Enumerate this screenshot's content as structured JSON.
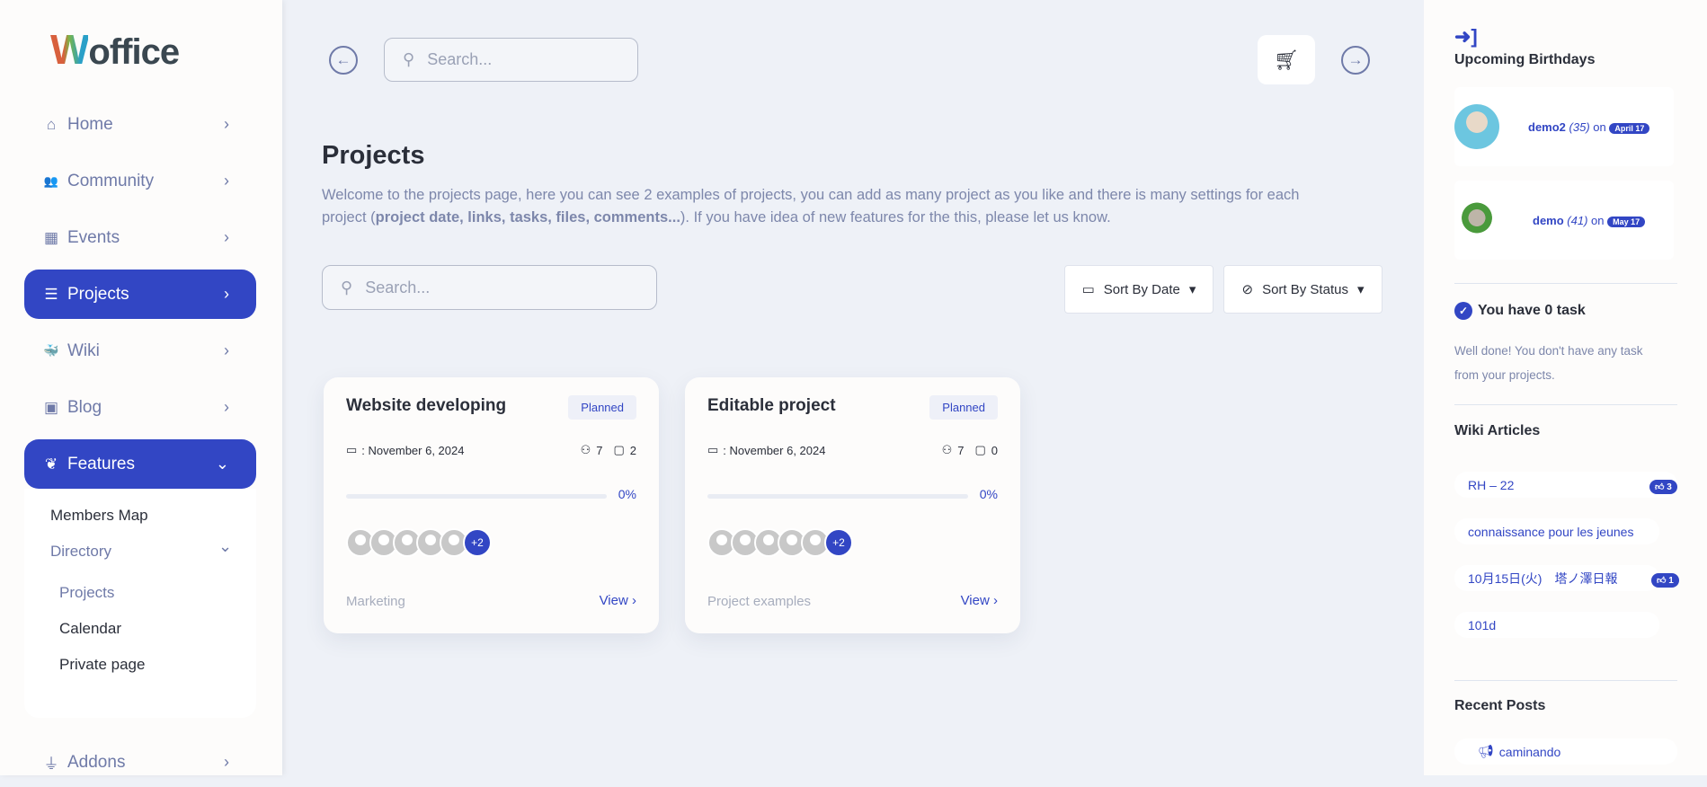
{
  "logo": {
    "text": "Woffice",
    "first": "W",
    "rest": "office"
  },
  "sidebar": {
    "items": [
      {
        "label": "Home",
        "icon": "home-icon",
        "glyph": "⌂"
      },
      {
        "label": "Community",
        "icon": "users-icon",
        "glyph": "👥"
      },
      {
        "label": "Events",
        "icon": "calendar-icon",
        "glyph": "▦"
      },
      {
        "label": "Projects",
        "icon": "tasks-icon",
        "glyph": "☰",
        "active": true
      },
      {
        "label": "Wiki",
        "icon": "docker-icon",
        "glyph": "🐳"
      },
      {
        "label": "Blog",
        "icon": "blogger-icon",
        "glyph": "▣"
      },
      {
        "label": "Features",
        "icon": "feather-icon",
        "glyph": "❦",
        "active": true,
        "expanded": true
      },
      {
        "label": "Addons",
        "icon": "plug-icon",
        "glyph": "⏚"
      }
    ],
    "features_sub": {
      "members_map": "Members Map",
      "directory": "Directory",
      "directory_items": [
        "Projects",
        "Calendar",
        "Private page"
      ]
    }
  },
  "topbar": {
    "search_placeholder": "Search..."
  },
  "page": {
    "title": "Projects",
    "desc_1": "Welcome to the projects page, here you can see 2 examples of projects, you can add as many project as you like and there is many settings for each",
    "desc_2a": "project (",
    "desc_bold": "project date, links, tasks, files, comments...",
    "desc_2b": "). If you have idea of new features for the this, please let us know."
  },
  "filters": {
    "search_placeholder": "Search...",
    "sort_date": "Sort By Date",
    "sort_status": "Sort By Status"
  },
  "projects": [
    {
      "title": "Website developing",
      "status": "Planned",
      "date": ": November 6, 2024",
      "members": "7",
      "comments": "2",
      "progress": "0%",
      "extra": "+2",
      "category": "Marketing",
      "view": "View"
    },
    {
      "title": "Editable project",
      "status": "Planned",
      "date": ": November 6, 2024",
      "members": "7",
      "comments": "0",
      "progress": "0%",
      "extra": "+2",
      "category": "Project examples",
      "view": "View"
    }
  ],
  "right": {
    "birthdays_title": "Upcoming Birthdays",
    "birthdays": [
      {
        "name": "demo2",
        "age": "(35)",
        "on": "on",
        "date": "April 17"
      },
      {
        "name": "demo",
        "age": "(41)",
        "on": "on",
        "date": "May 17"
      }
    ],
    "task_title": "You have 0 task",
    "task_text": "Well done! You don't have any task from your projects.",
    "wiki_title": "Wiki Articles",
    "wiki": [
      {
        "title": "RH – 22",
        "likes": "3"
      },
      {
        "title": "connaissance pour les jeunes"
      },
      {
        "title": "10月15日(火)　塔ノ澤日報",
        "likes": "1"
      },
      {
        "title": "101d"
      }
    ],
    "posts_title": "Recent Posts",
    "posts": [
      "caminando"
    ]
  },
  "colors": {
    "accent": "#3246c4",
    "background": "#eef1f7",
    "muted": "#6f7aa8"
  }
}
